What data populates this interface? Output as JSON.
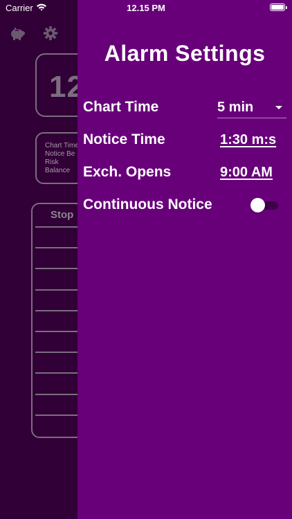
{
  "status_bar": {
    "carrier": "Carrier",
    "time": "12.15 PM"
  },
  "background": {
    "time_display": "12",
    "info_lines": [
      "Chart Time",
      "Notice Be",
      "Risk",
      "Balance"
    ],
    "table_header": "Stop"
  },
  "drawer": {
    "title": "Alarm Settings",
    "chart_time": {
      "label": "Chart Time",
      "value": "5 min"
    },
    "notice_time": {
      "label": "Notice Time",
      "value": "1:30 m:s"
    },
    "exch_opens": {
      "label": "Exch. Opens",
      "value": "9:00 AM"
    },
    "continuous_notice": {
      "label": "Continuous Notice",
      "enabled": false
    }
  },
  "colors": {
    "drawer_bg": "#68007a",
    "screen_bg": "#310036",
    "outline": "#7b6e7f"
  },
  "icons": [
    "wifi-icon",
    "battery-icon",
    "piggy-bank-icon",
    "gear-icon",
    "chevron-down-icon"
  ]
}
